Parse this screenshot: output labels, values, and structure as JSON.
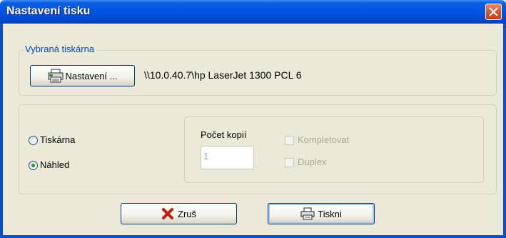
{
  "window": {
    "title": "Nastavení tisku",
    "close_icon": "close-icon"
  },
  "printer_group": {
    "label": "Vybraná tiskárna",
    "settings_button": "Nastavení ...",
    "printer_name": "\\\\10.0.40.7\\hp LaserJet 1300 PCL 6"
  },
  "output": {
    "options": [
      {
        "label": "Tiskárna",
        "selected": false
      },
      {
        "label": "Náhled",
        "selected": true
      }
    ],
    "copies_label": "Počet kopií",
    "copies_value": "1",
    "collate_label": "Kompletovat",
    "duplex_label": "Duplex"
  },
  "buttons": {
    "cancel": "Zruš",
    "print": "Tiskni"
  },
  "colors": {
    "title_bar": "#0054e3",
    "close": "#d6532b",
    "group_label": "#0046d5",
    "dialog_bg": "#ece9d8"
  }
}
